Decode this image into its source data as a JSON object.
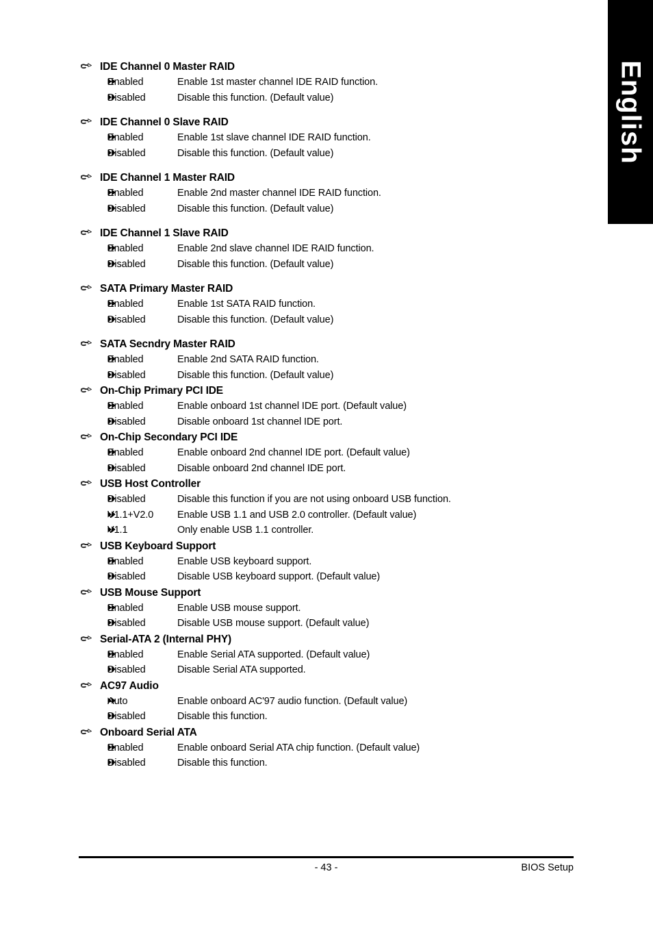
{
  "language_tab": {
    "label": "English"
  },
  "icons": {
    "section_bullet": "hand-pointer-icon",
    "option_bullet": "double-triangle-right-icon"
  },
  "footer": {
    "page_number": "- 43 -",
    "right_label": "BIOS Setup"
  },
  "sections": [
    {
      "title": "IDE Channel 0 Master RAID",
      "spaced": true,
      "options": [
        {
          "label": "Enabled",
          "desc": "Enable 1st master channel IDE RAID function."
        },
        {
          "label": "Disabled",
          "desc": "Disable this function. (Default value)"
        }
      ]
    },
    {
      "title": "IDE Channel 0 Slave RAID",
      "spaced": true,
      "options": [
        {
          "label": "Enabled",
          "desc": "Enable 1st slave channel IDE RAID function."
        },
        {
          "label": "Disabled",
          "desc": "Disable this function. (Default value)"
        }
      ]
    },
    {
      "title": "IDE Channel 1 Master RAID",
      "spaced": true,
      "options": [
        {
          "label": "Enabled",
          "desc": "Enable 2nd master channel IDE RAID function."
        },
        {
          "label": "Disabled",
          "desc": "Disable this function. (Default value)"
        }
      ]
    },
    {
      "title": "IDE Channel 1 Slave RAID",
      "spaced": true,
      "options": [
        {
          "label": "Enabled",
          "desc": "Enable 2nd slave channel IDE RAID function."
        },
        {
          "label": "Disabled",
          "desc": "Disable this function. (Default value)"
        }
      ]
    },
    {
      "title": "SATA Primary Master RAID",
      "spaced": true,
      "options": [
        {
          "label": "Enabled",
          "desc": "Enable 1st SATA RAID function."
        },
        {
          "label": "Disabled",
          "desc": "Disable this function. (Default value)"
        }
      ]
    },
    {
      "title": "SATA Secndry Master RAID",
      "spaced": false,
      "options": [
        {
          "label": "Enabled",
          "desc": "Enable 2nd SATA RAID function."
        },
        {
          "label": "Disabled",
          "desc": "Disable this function. (Default value)"
        }
      ]
    },
    {
      "title": "On-Chip Primary PCI IDE",
      "spaced": false,
      "options": [
        {
          "label": "Enabled",
          "desc": "Enable onboard 1st channel IDE port. (Default value)"
        },
        {
          "label": "Disabled",
          "desc": "Disable onboard 1st channel IDE port."
        }
      ]
    },
    {
      "title": "On-Chip Secondary PCI IDE",
      "spaced": false,
      "options": [
        {
          "label": "Enabled",
          "desc": "Enable onboard 2nd channel IDE port. (Default value)"
        },
        {
          "label": "Disabled",
          "desc": "Disable onboard 2nd channel IDE port."
        }
      ]
    },
    {
      "title": "USB Host Controller",
      "spaced": false,
      "options": [
        {
          "label": "Disabled",
          "desc": "Disable this function if you are not using onboard USB function."
        },
        {
          "label": "V1.1+V2.0",
          "desc": "Enable USB 1.1 and USB 2.0 controller. (Default value)"
        },
        {
          "label": "V1.1",
          "desc": "Only enable USB 1.1 controller."
        }
      ]
    },
    {
      "title": "USB Keyboard Support",
      "spaced": false,
      "options": [
        {
          "label": "Enabled",
          "desc": "Enable USB keyboard support."
        },
        {
          "label": "Disabled",
          "desc": "Disable USB keyboard support. (Default value)"
        }
      ]
    },
    {
      "title": "USB Mouse Support",
      "spaced": false,
      "options": [
        {
          "label": "Enabled",
          "desc": "Enable USB mouse support."
        },
        {
          "label": "Disabled",
          "desc": "Disable USB mouse support. (Default value)"
        }
      ]
    },
    {
      "title": "Serial-ATA 2 (Internal PHY)",
      "spaced": false,
      "options": [
        {
          "label": "Enabled",
          "desc": "Enable Serial ATA supported. (Default value)"
        },
        {
          "label": "Disabled",
          "desc": "Disable Serial ATA supported."
        }
      ]
    },
    {
      "title": "AC97 Audio",
      "spaced": false,
      "options": [
        {
          "label": "Auto",
          "desc": "Enable onboard AC'97 audio function. (Default value)"
        },
        {
          "label": "Disabled",
          "desc": "Disable this function."
        }
      ]
    },
    {
      "title": "Onboard Serial ATA",
      "spaced": false,
      "options": [
        {
          "label": "Enabled",
          "desc": "Enable onboard Serial ATA chip function. (Default value)"
        },
        {
          "label": "Disabled",
          "desc": "Disable this function."
        }
      ]
    }
  ]
}
